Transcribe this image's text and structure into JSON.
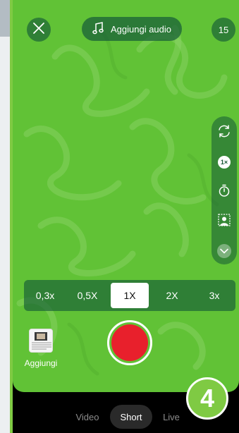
{
  "top_bar": {
    "close_icon": "close-icon",
    "add_audio_label": "Aggiungi audio",
    "add_audio_icon": "music-note-icon",
    "timer_value": "15"
  },
  "tools": [
    {
      "name": "flip-camera",
      "icon": "flip-camera-icon"
    },
    {
      "name": "speed",
      "icon": "speed-icon",
      "label": "1×"
    },
    {
      "name": "timer",
      "icon": "stopwatch-icon"
    },
    {
      "name": "green-screen",
      "icon": "green-screen-icon"
    },
    {
      "name": "more",
      "icon": "chevron-down-icon"
    }
  ],
  "zoom": {
    "options": [
      "0,3x",
      "0,5X",
      "1X",
      "2X",
      "3x"
    ],
    "selected": "1X"
  },
  "gallery": {
    "label": "Aggiungi"
  },
  "modes": {
    "tabs": [
      "Video",
      "Short",
      "Live"
    ],
    "selected": "Short"
  },
  "step_badge": "4",
  "colors": {
    "screen_green": "#61c236",
    "record_red": "#e8202c",
    "badge_green": "#7fca43"
  }
}
